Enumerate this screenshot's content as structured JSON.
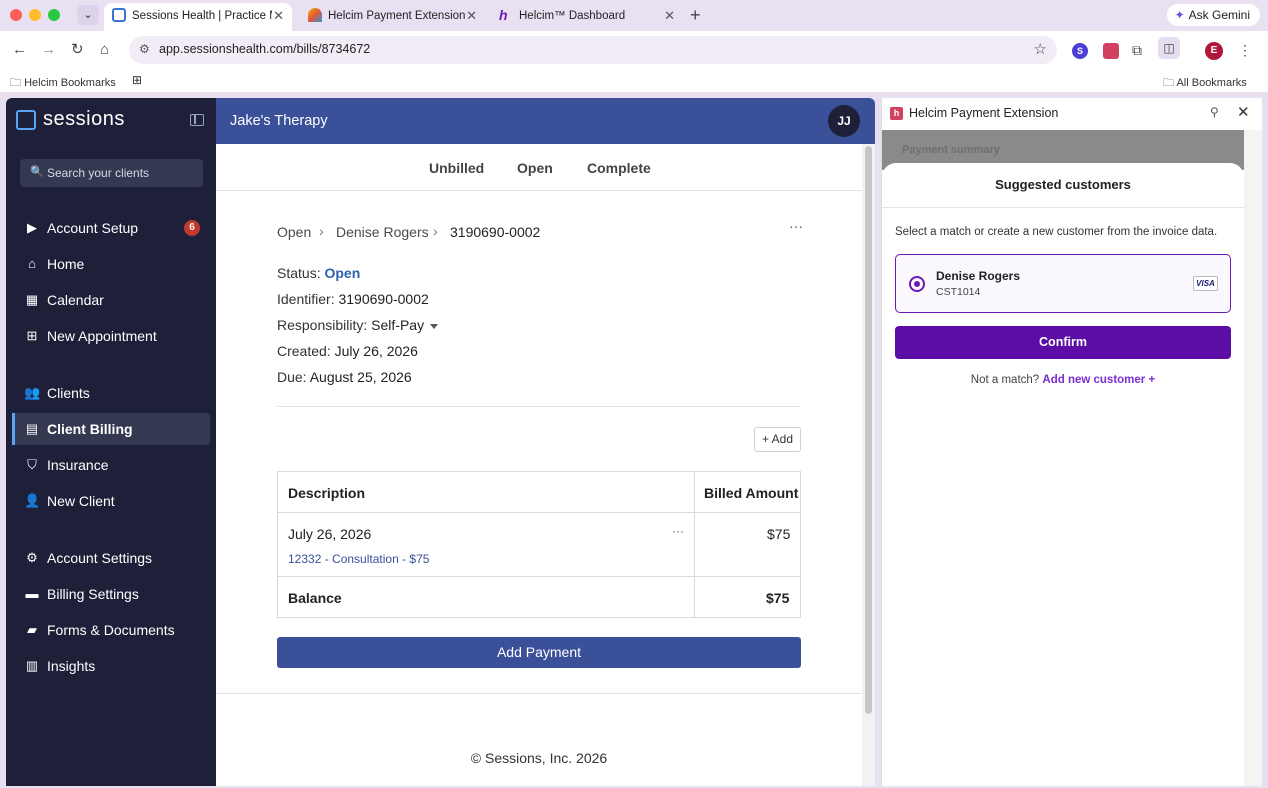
{
  "browser": {
    "tabs": [
      {
        "title": "Sessions Health | Practice Ma",
        "active": true
      },
      {
        "title": "Helcim Payment Extension - C",
        "active": false
      },
      {
        "title": "Helcim™ Dashboard",
        "active": false
      }
    ],
    "gemini_label": "Ask Gemini",
    "url": "app.sessionshealth.com/bills/8734672",
    "profile_initial": "E",
    "extension_initial": "S",
    "bookmarks": {
      "left": "Helcim Bookmarks",
      "right": "All Bookmarks"
    }
  },
  "sidebar": {
    "brand": "sessions",
    "search_placeholder": "Search your clients",
    "items": [
      {
        "label": "Account Setup",
        "icon": "play-circle-icon",
        "badge": "6"
      },
      {
        "label": "Home",
        "icon": "home-icon"
      },
      {
        "label": "Calendar",
        "icon": "calendar-icon"
      },
      {
        "label": "New Appointment",
        "icon": "calendar-plus-icon"
      },
      {
        "label": "Clients",
        "icon": "users-icon"
      },
      {
        "label": "Client Billing",
        "icon": "id-card-icon",
        "active": true
      },
      {
        "label": "Insurance",
        "icon": "shield-icon"
      },
      {
        "label": "New Client",
        "icon": "user-plus-icon"
      },
      {
        "label": "Account Settings",
        "icon": "gear-icon"
      },
      {
        "label": "Billing Settings",
        "icon": "credit-card-icon"
      },
      {
        "label": "Forms & Documents",
        "icon": "folder-icon"
      },
      {
        "label": "Insights",
        "icon": "chart-icon"
      }
    ]
  },
  "header": {
    "practice": "Jake's Therapy",
    "avatar": "JJ"
  },
  "bill_tabs": [
    "Unbilled",
    "Open",
    "Complete"
  ],
  "breadcrumb": [
    "Open",
    "Denise Rogers",
    "3190690-0002"
  ],
  "bill": {
    "status_label": "Status:",
    "status": "Open",
    "identifier_label": "Identifier:",
    "identifier": "3190690-0002",
    "responsibility_label": "Responsibility:",
    "responsibility": "Self-Pay",
    "created_label": "Created:",
    "created": "July 26, 2026",
    "due_label": "Due:",
    "due": "August 25, 2026"
  },
  "add_label": "+ Add",
  "table": {
    "headers": [
      "Description",
      "Billed Amount"
    ],
    "row": {
      "date": "July 26, 2026",
      "detail": "12332 - Consultation - $75",
      "amount": "$75"
    },
    "balance_label": "Balance",
    "balance": "$75"
  },
  "add_payment_label": "Add Payment",
  "footer": "© Sessions, Inc. 2026",
  "extension": {
    "title": "Helcim Payment Extension",
    "background_title": "Payment summary",
    "card_title": "Suggested customers",
    "description": "Select a match or create a new customer from the invoice data.",
    "customer": {
      "name": "Denise Rogers",
      "id": "CST1014",
      "card_brand": "VISA"
    },
    "confirm_label": "Confirm",
    "no_match_text": "Not a match?",
    "add_new_label": "Add new customer +"
  }
}
